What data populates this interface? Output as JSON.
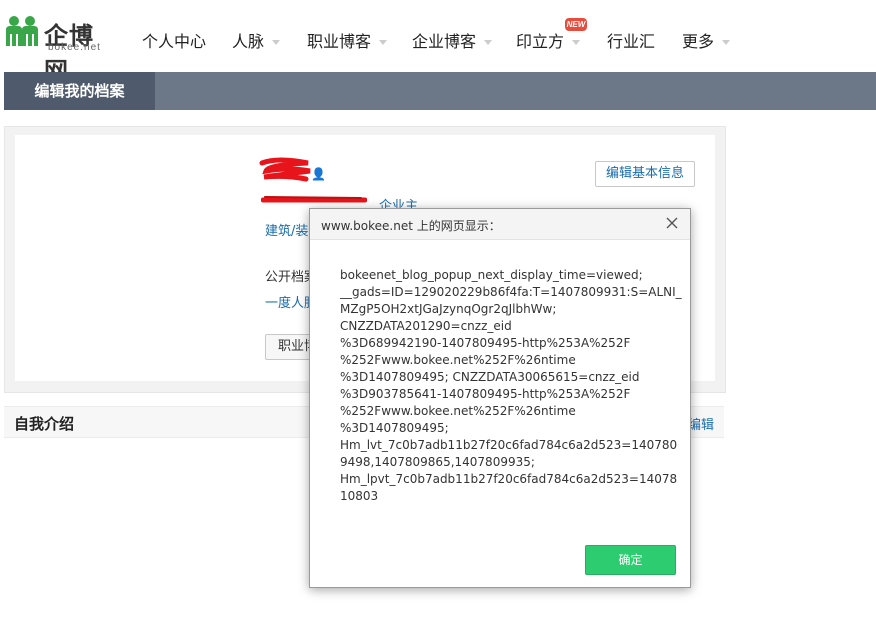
{
  "logo": {
    "name": "企博网",
    "domain": "bokee.net"
  },
  "nav": {
    "items": [
      {
        "label": "个人中心",
        "dropdown": false
      },
      {
        "label": "人脉",
        "dropdown": true
      },
      {
        "label": "职业博客",
        "dropdown": true
      },
      {
        "label": "企业博客",
        "dropdown": true
      },
      {
        "label": "印立方",
        "dropdown": true,
        "badge": "NEW"
      },
      {
        "label": "行业汇",
        "dropdown": false
      },
      {
        "label": "更多",
        "dropdown": true
      }
    ]
  },
  "page_header": {
    "tab": "编辑我的档案"
  },
  "profile": {
    "edit_basic_button": "编辑基本信息",
    "company_link": "企业主",
    "industry_link": "建筑/装饰",
    "public_label": "公开档案",
    "network_link": "一度人脉",
    "job_button": "职业博"
  },
  "intro": {
    "title": "自我介绍",
    "edit": "编辑"
  },
  "dialog": {
    "title": "www.bokee.net 上的网页显示：",
    "message_lines": [
      "bokeenet_blog_popup_next_display_time=viewed;",
      "__gads=ID=129020229b86f4fa:T=1407809931:S=ALNI_",
      "MZgP5OH2xtJGaJzynqOgr2qJlbhWw;",
      "CNZZDATA201290=cnzz_eid",
      "%3D689942190-1407809495-http%253A%252F",
      "%252Fwww.bokee.net%252F%26ntime",
      "%3D1407809495; CNZZDATA30065615=cnzz_eid",
      "%3D903785641-1407809495-http%253A%252F",
      "%252Fwww.bokee.net%252F%26ntime",
      "%3D1407809495;",
      "Hm_lvt_7c0b7adb11b27f20c6fad784c6a2d523=140780",
      "9498,1407809865,1407809935;",
      "Hm_lpvt_7c0b7adb11b27f20c6fad784c6a2d523=14078",
      "10803"
    ],
    "ok_button": "确定"
  },
  "colors": {
    "nav_bar": "#6c7788",
    "nav_tab_active": "#4f5a6c",
    "link": "#1a6cae",
    "ok_button": "#2ecc71",
    "badge": "#e74c3c",
    "logo_green": "#3aa64a"
  }
}
